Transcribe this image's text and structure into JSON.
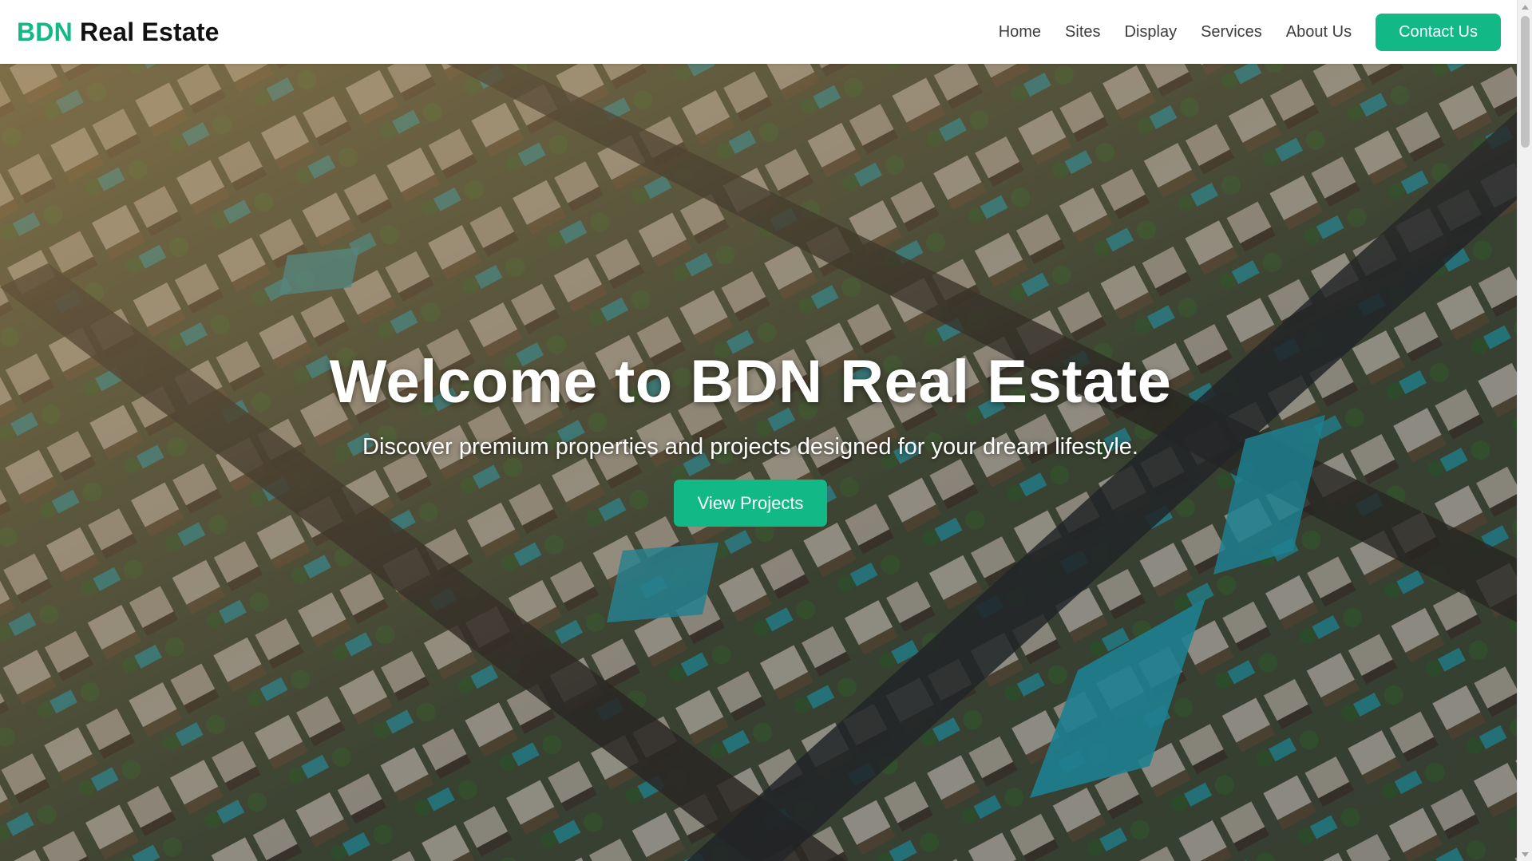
{
  "brand": {
    "accent": "BDN",
    "rest": "Real Estate"
  },
  "nav": {
    "links": [
      "Home",
      "Sites",
      "Display",
      "Services",
      "About Us"
    ],
    "cta": "Contact Us"
  },
  "hero": {
    "title": "Welcome to BDN Real Estate",
    "subtitle": "Discover premium properties and projects designed for your dream lifestyle.",
    "cta": "View Projects",
    "background_image": "aerial-view-of-modern-residential-villas-with-pools"
  },
  "colors": {
    "accent": "#12b886",
    "nav_text": "#3d3d3d",
    "brand_text": "#111111"
  },
  "icons": {
    "scroll_up": "chevron-up-icon",
    "scroll_down": "chevron-down-icon"
  }
}
